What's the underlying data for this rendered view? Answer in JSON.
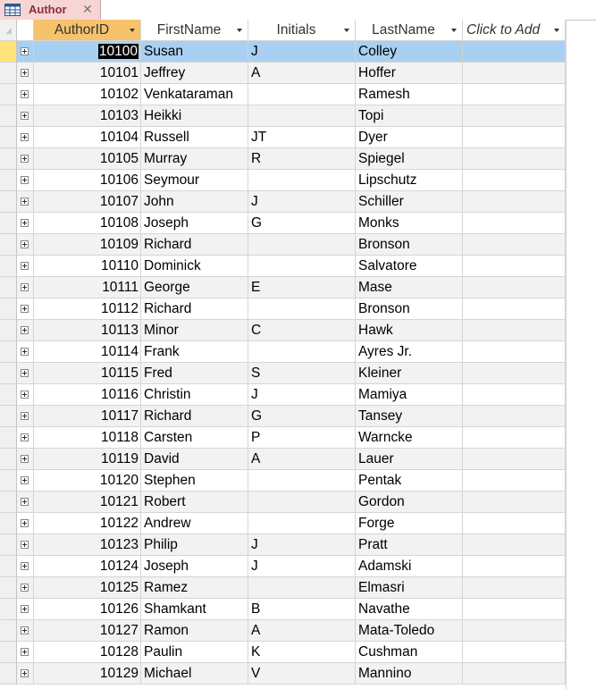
{
  "tab": {
    "title": "Author",
    "close": "✕"
  },
  "columns": {
    "author_id": "AuthorID",
    "first_name": "FirstName",
    "initials": "Initials",
    "last_name": "LastName",
    "click_to_add": "Click to Add"
  },
  "rows": [
    {
      "id": "10100",
      "first": "Susan",
      "init": "J",
      "last": "Colley"
    },
    {
      "id": "10101",
      "first": "Jeffrey",
      "init": "A",
      "last": "Hoffer"
    },
    {
      "id": "10102",
      "first": "Venkataraman",
      "init": "",
      "last": "Ramesh"
    },
    {
      "id": "10103",
      "first": "Heikki",
      "init": "",
      "last": "Topi"
    },
    {
      "id": "10104",
      "first": "Russell",
      "init": "JT",
      "last": "Dyer"
    },
    {
      "id": "10105",
      "first": "Murray",
      "init": "R",
      "last": "Spiegel"
    },
    {
      "id": "10106",
      "first": "Seymour",
      "init": "",
      "last": "Lipschutz"
    },
    {
      "id": "10107",
      "first": "John",
      "init": "J",
      "last": "Schiller"
    },
    {
      "id": "10108",
      "first": "Joseph",
      "init": "G",
      "last": "Monks"
    },
    {
      "id": "10109",
      "first": "Richard",
      "init": "",
      "last": "Bronson"
    },
    {
      "id": "10110",
      "first": "Dominick",
      "init": "",
      "last": "Salvatore"
    },
    {
      "id": "10111",
      "first": "George",
      "init": "E",
      "last": "Mase"
    },
    {
      "id": "10112",
      "first": "Richard",
      "init": "",
      "last": "Bronson"
    },
    {
      "id": "10113",
      "first": "Minor",
      "init": "C",
      "last": "Hawk"
    },
    {
      "id": "10114",
      "first": "Frank",
      "init": "",
      "last": "Ayres Jr."
    },
    {
      "id": "10115",
      "first": "Fred",
      "init": "S",
      "last": "Kleiner"
    },
    {
      "id": "10116",
      "first": "Christin",
      "init": "J",
      "last": "Mamiya"
    },
    {
      "id": "10117",
      "first": "Richard",
      "init": "G",
      "last": "Tansey"
    },
    {
      "id": "10118",
      "first": "Carsten",
      "init": "P",
      "last": "Warncke"
    },
    {
      "id": "10119",
      "first": "David",
      "init": "A",
      "last": "Lauer"
    },
    {
      "id": "10120",
      "first": "Stephen",
      "init": "",
      "last": "Pentak"
    },
    {
      "id": "10121",
      "first": "Robert",
      "init": "",
      "last": "Gordon"
    },
    {
      "id": "10122",
      "first": "Andrew",
      "init": "",
      "last": "Forge"
    },
    {
      "id": "10123",
      "first": "Philip",
      "init": "J",
      "last": "Pratt"
    },
    {
      "id": "10124",
      "first": "Joseph",
      "init": "J",
      "last": "Adamski"
    },
    {
      "id": "10125",
      "first": "Ramez",
      "init": "",
      "last": "Elmasri"
    },
    {
      "id": "10126",
      "first": "Shamkant",
      "init": "B",
      "last": "Navathe"
    },
    {
      "id": "10127",
      "first": "Ramon",
      "init": "A",
      "last": "Mata-Toledo"
    },
    {
      "id": "10128",
      "first": "Paulin",
      "init": "K",
      "last": "Cushman"
    },
    {
      "id": "10129",
      "first": "Michael",
      "init": "V",
      "last": "Mannino"
    }
  ],
  "colors": {
    "tab_bg": "#f7d5d5",
    "tab_text": "#8a2e3e",
    "header_sorted": "#f6c26b",
    "current_row": "#a9d0f2",
    "record_selector_current": "#ffe27a",
    "alt_row": "#f2f2f2"
  }
}
